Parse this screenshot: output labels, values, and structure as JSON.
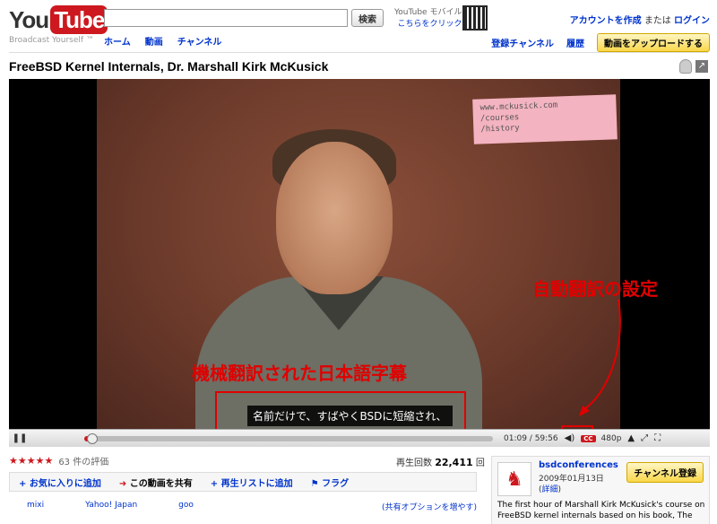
{
  "header": {
    "logo_you": "You",
    "logo_tube": "Tube",
    "tagline": "Broadcast Yourself ™",
    "search_button": "検索",
    "search_value": "",
    "nav": [
      "ホーム",
      "動画",
      "チャンネル"
    ],
    "mobile_line1": "YouTube モバイル",
    "mobile_line2": "こちらをクリック",
    "create_account": "アカウントを作成",
    "or": "または",
    "login": "ログイン",
    "subscriptions": "登録チャンネル",
    "history": "履歴",
    "upload": "動画をアップロードする"
  },
  "video": {
    "title": "FreeBSD Kernel Internals, Dr. Marshall Kirk McKusick",
    "note_line1": "www.mckusick.com",
    "note_line2": "/courses",
    "note_line3": "/history",
    "subtitle": "名前だけで、すばやくBSDに短縮され、",
    "time": "01:09 / 59:56",
    "cc_label": "CC",
    "quality": "480p",
    "progress_fraction": 0.02
  },
  "annotations": {
    "machine_translation": "機械翻訳された日本語字幕",
    "auto_translate": "自動翻訳の設定",
    "accent": "#e00000"
  },
  "below": {
    "stars": "★★★★★",
    "rating_count": "63 件の評価",
    "views_label": "再生回数",
    "views_count": "22,411",
    "views_unit": "回",
    "actions": [
      "お気に入りに追加",
      "この動画を共有",
      "再生リストに追加",
      "フラグ"
    ],
    "share_links": [
      "mixi",
      "Yahoo! Japan",
      "goo"
    ],
    "share_options": "(共有オプションを増やす)"
  },
  "channel": {
    "name": "bsdconferences",
    "date": "2009年01月13日",
    "detail_prefix": "(",
    "detail": "詳細",
    "detail_suffix": ")",
    "subscribe": "チャンネル登録",
    "description": "The first hour of Marshall Kirk McKusick's course on FreeBSD kernel internals based on his book, The"
  }
}
